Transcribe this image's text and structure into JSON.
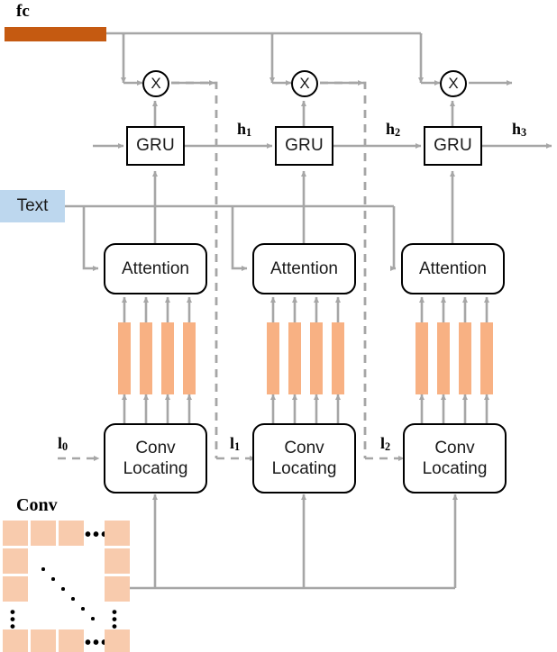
{
  "diagram": {
    "title_labels": {
      "fc": "fc",
      "conv": "Conv",
      "text": "Text"
    },
    "colors": {
      "fc_bar": "#c55a11",
      "feature_bar": "#f8b183",
      "conv_cell": "#f8cbad",
      "text_box": "#bdd7ee",
      "wire": "#a6a6a6",
      "node_border": "#000000"
    },
    "gru_cells": [
      {
        "label": "GRU",
        "output_label": "h",
        "output_sub": "1"
      },
      {
        "label": "GRU",
        "output_label": "h",
        "output_sub": "2"
      },
      {
        "label": "GRU",
        "output_label": "h",
        "output_sub": "3"
      }
    ],
    "multiply_nodes": [
      {
        "label": "X"
      },
      {
        "label": "X"
      },
      {
        "label": "X"
      }
    ],
    "attention_blocks": [
      {
        "label": "Attention"
      },
      {
        "label": "Attention"
      },
      {
        "label": "Attention"
      }
    ],
    "conv_locating_blocks": [
      {
        "line1": "Conv",
        "line2": "Locating",
        "input_label": "l",
        "input_sub": "0"
      },
      {
        "line1": "Conv",
        "line2": "Locating",
        "input_label": "l",
        "input_sub": "1"
      },
      {
        "line1": "Conv",
        "line2": "Locating",
        "input_label": "l",
        "input_sub": "2"
      }
    ],
    "location_labels": [
      {
        "base": "l",
        "sub": "0"
      },
      {
        "base": "l",
        "sub": "1"
      },
      {
        "base": "l",
        "sub": "2"
      }
    ],
    "hidden_labels": [
      {
        "base": "h",
        "sub": "1"
      },
      {
        "base": "h",
        "sub": "2"
      },
      {
        "base": "h",
        "sub": "3"
      }
    ],
    "feature_bars_per_block": 4,
    "conv_grid": {
      "ellipsis_horizontal": "•••",
      "ellipsis_vertical": "•••"
    }
  }
}
